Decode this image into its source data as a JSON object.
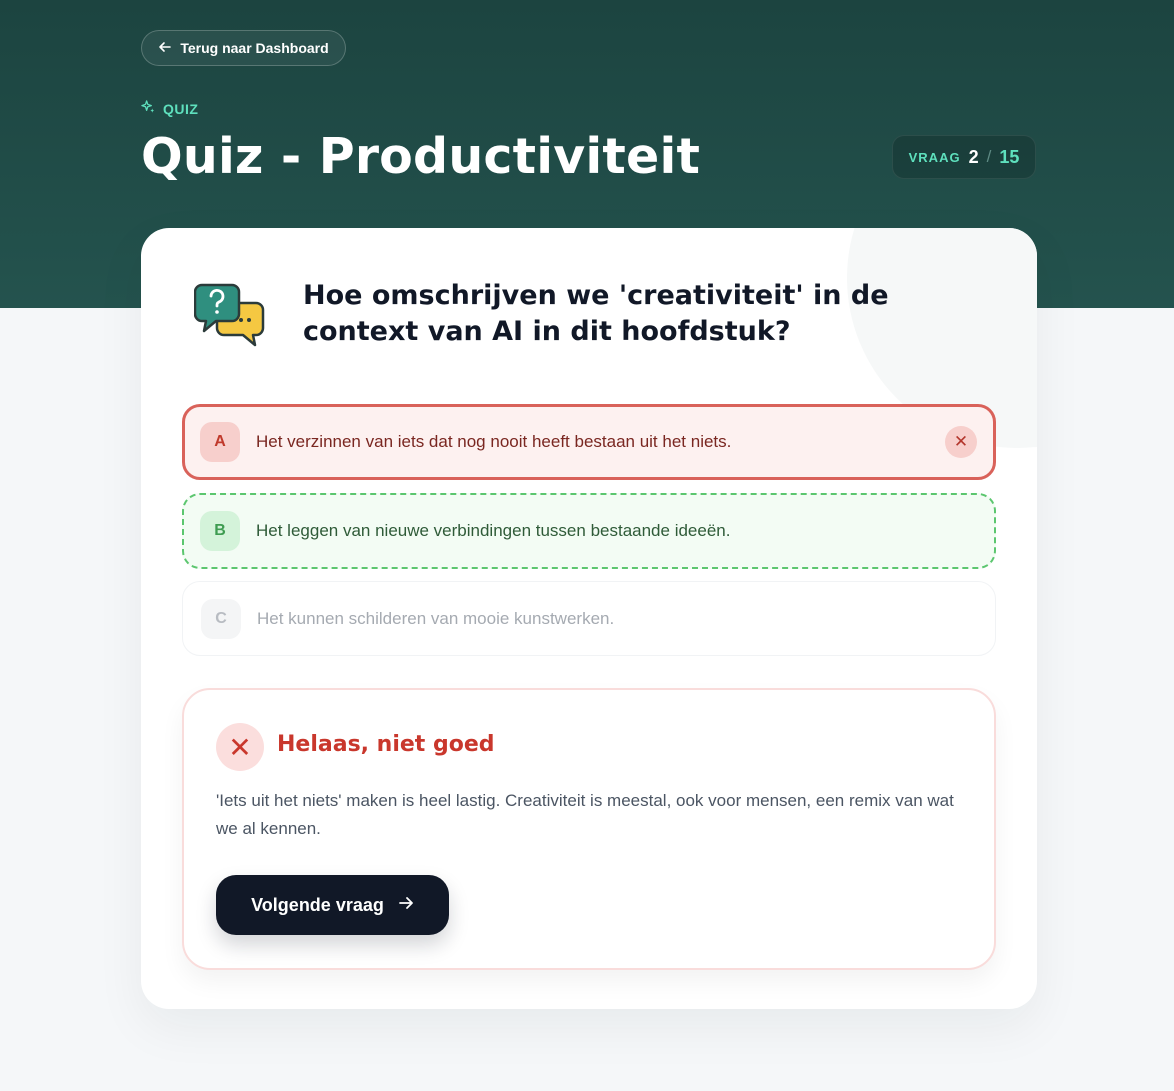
{
  "header": {
    "back_label": "Terug naar Dashboard",
    "tag_label": "QUIZ",
    "title": "Quiz - Productiviteit",
    "progress": {
      "label": "VRAAG",
      "current": "2",
      "separator": "/",
      "total": "15"
    }
  },
  "question": {
    "text": "Hoe omschrijven we 'creativiteit' in de context van AI in dit hoofdstuk?"
  },
  "options": [
    {
      "letter": "A",
      "text": "Het verzinnen van iets dat nog nooit heeft bestaan uit het niets.",
      "state": "selected-wrong"
    },
    {
      "letter": "B",
      "text": "Het leggen van nieuwe verbindingen tussen bestaande ideeën.",
      "state": "correct"
    },
    {
      "letter": "C",
      "text": "Het kunnen schilderen van mooie kunstwerken.",
      "state": "neutral"
    }
  ],
  "feedback": {
    "title": "Helaas, niet goed",
    "text": "'Iets uit het niets' maken is heel lastig. Creativiteit is meestal, ook voor mensen, een remix van wat we al kennen.",
    "next_label": "Volgende vraag"
  },
  "colors": {
    "header_bg": "#1c4440",
    "accent": "#5ee0bd",
    "wrong": "#d9625a",
    "correct": "#5cc66f",
    "button_dark": "#111827"
  },
  "icons": [
    "arrow-left-icon",
    "sparkles-icon",
    "question-chat-icon",
    "close-icon",
    "x-icon",
    "arrow-right-icon"
  ]
}
